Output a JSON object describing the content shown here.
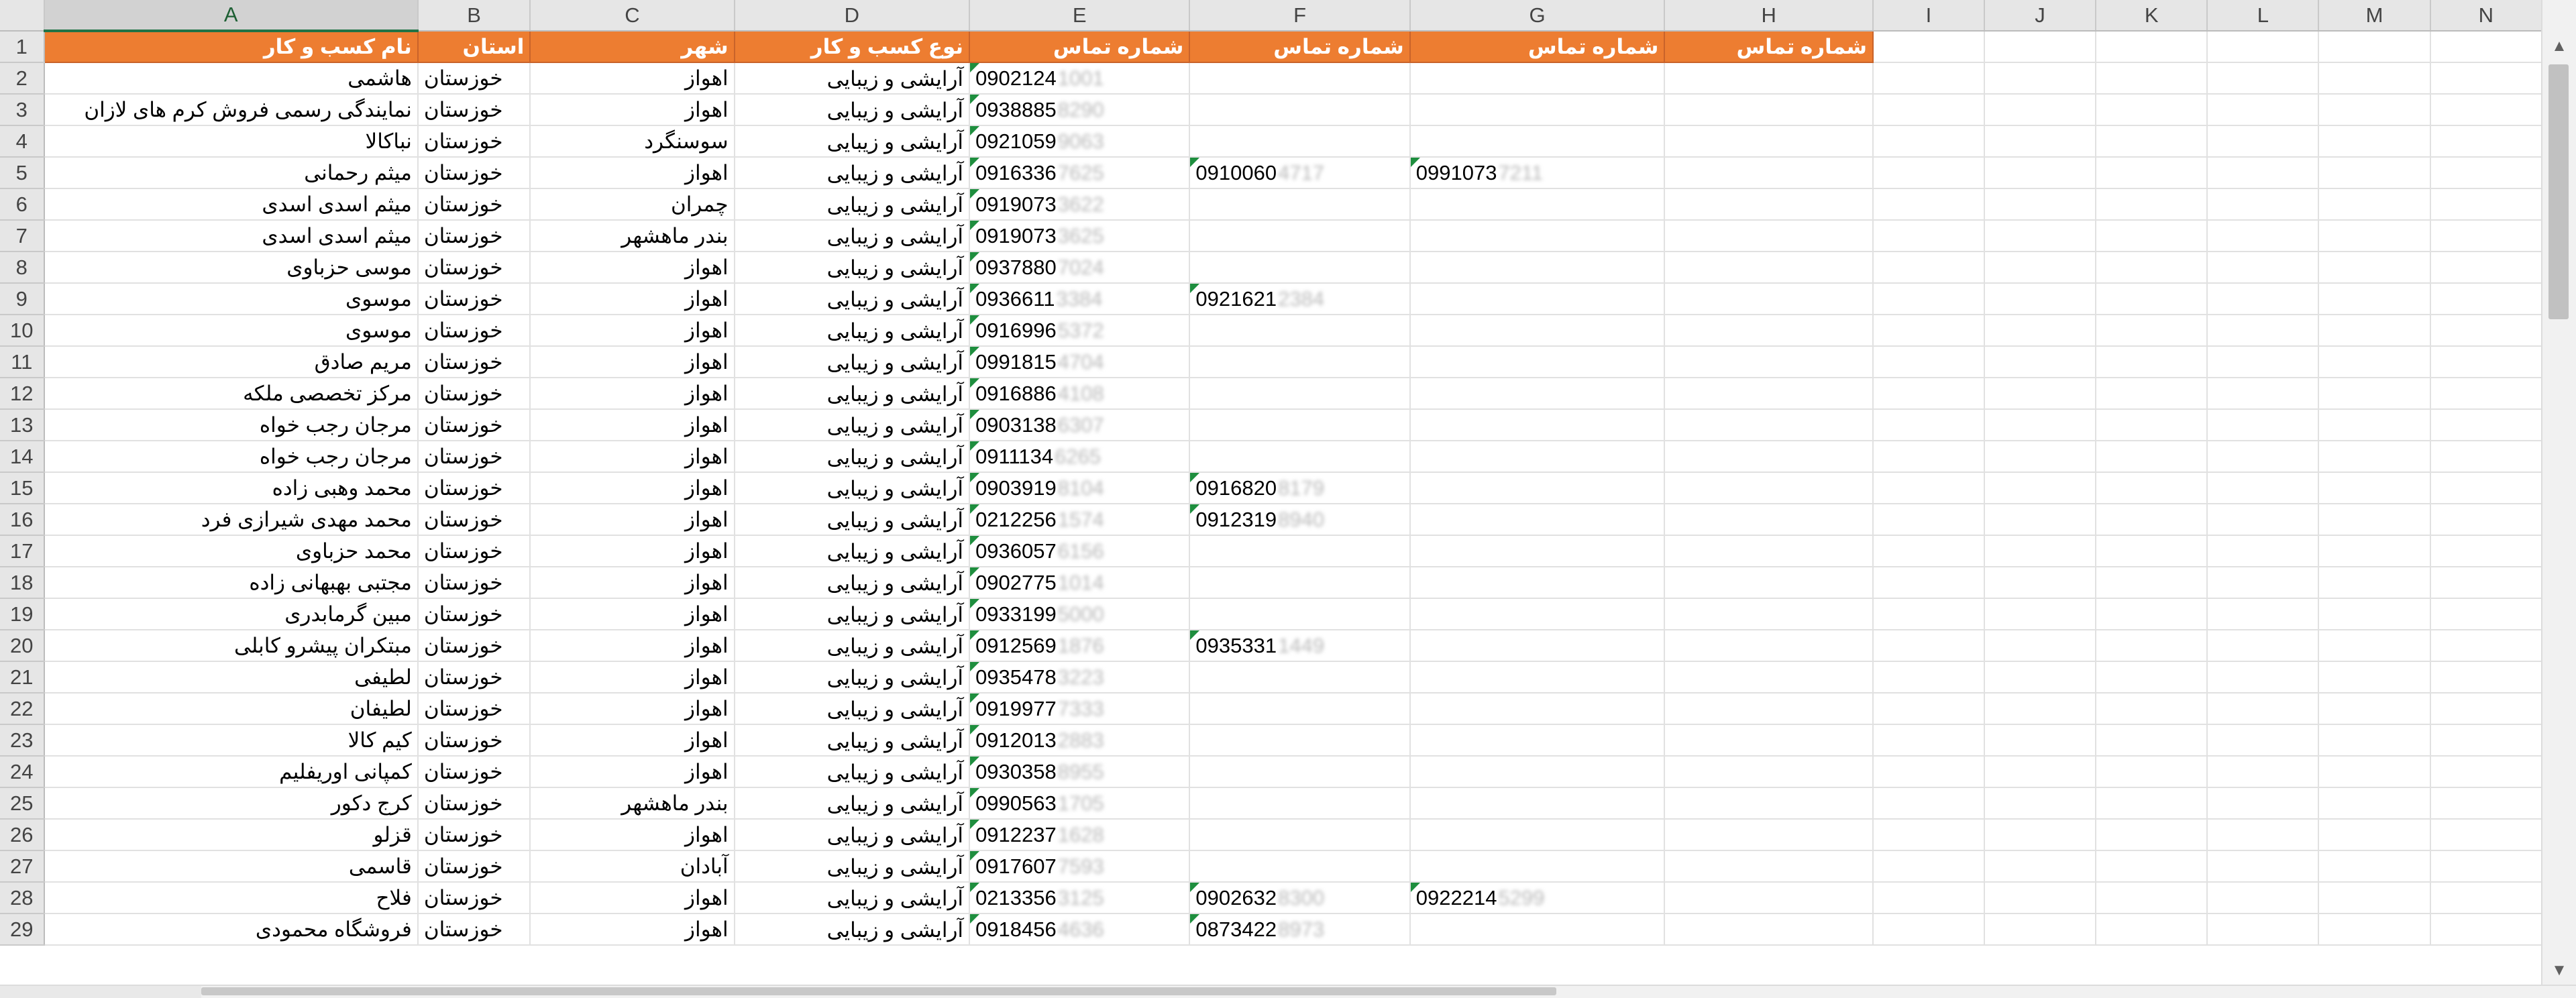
{
  "columns": [
    "A",
    "B",
    "C",
    "D",
    "E",
    "F",
    "G",
    "H",
    "I",
    "J",
    "K",
    "L",
    "M",
    "N"
  ],
  "header_row": {
    "row": "1",
    "A": "نام کسب و کار",
    "B": "استان",
    "C": "شهر",
    "D": "نوع کسب  و کار",
    "E": "شماره تماس",
    "F": "شماره تماس",
    "G": "شماره تماس",
    "H": "شماره تماس"
  },
  "rows": [
    {
      "row": "2",
      "name": "هاشمی",
      "province": "خوزستان",
      "city": "اهواز",
      "type": "آرایشی و زیبایی",
      "e": "0902124",
      "e_h": "1001",
      "f": "",
      "f_h": "",
      "g": "",
      "g_h": ""
    },
    {
      "row": "3",
      "name": "نمایندگی رسمی فروش کرم های لازان",
      "province": "خوزستان",
      "city": "اهواز",
      "type": "آرایشی و زیبایی",
      "e": "0938885",
      "e_h": "8290",
      "f": "",
      "f_h": "",
      "g": "",
      "g_h": ""
    },
    {
      "row": "4",
      "name": "نباکالا",
      "province": "خوزستان",
      "city": "سوسنگرد",
      "type": "آرایشی و زیبایی",
      "e": "0921059",
      "e_h": "9063",
      "f": "",
      "f_h": "",
      "g": "",
      "g_h": ""
    },
    {
      "row": "5",
      "name": "میثم رحمانی",
      "province": "خوزستان",
      "city": "اهواز",
      "type": "آرایشی و زیبایی",
      "e": "0916336",
      "e_h": "7625",
      "f": "0910060",
      "f_h": "4717",
      "g": "0991073",
      "g_h": "7211"
    },
    {
      "row": "6",
      "name": "میثم اسدی اسدی",
      "province": "خوزستان",
      "city": "چمران",
      "type": "آرایشی و زیبایی",
      "e": "0919073",
      "e_h": "3622",
      "f": "",
      "f_h": "",
      "g": "",
      "g_h": ""
    },
    {
      "row": "7",
      "name": "میثم اسدی اسدی",
      "province": "خوزستان",
      "city": "بندر ماهشهر",
      "type": "آرایشی و زیبایی",
      "e": "0919073",
      "e_h": "3625",
      "f": "",
      "f_h": "",
      "g": "",
      "g_h": ""
    },
    {
      "row": "8",
      "name": "موسی حزباوی",
      "province": "خوزستان",
      "city": "اهواز",
      "type": "آرایشی و زیبایی",
      "e": "0937880",
      "e_h": "7024",
      "f": "",
      "f_h": "",
      "g": "",
      "g_h": ""
    },
    {
      "row": "9",
      "name": "موسوی",
      "province": "خوزستان",
      "city": "اهواز",
      "type": "آرایشی و زیبایی",
      "e": "0936611",
      "e_h": "3384",
      "f": "0921621",
      "f_h": "2384",
      "g": "",
      "g_h": ""
    },
    {
      "row": "10",
      "name": "موسوی",
      "province": "خوزستان",
      "city": "اهواز",
      "type": "آرایشی و زیبایی",
      "e": "0916996",
      "e_h": "5372",
      "f": "",
      "f_h": "",
      "g": "",
      "g_h": ""
    },
    {
      "row": "11",
      "name": "مریم صادق",
      "province": "خوزستان",
      "city": "اهواز",
      "type": "آرایشی و زیبایی",
      "e": "0991815",
      "e_h": "4704",
      "f": "",
      "f_h": "",
      "g": "",
      "g_h": ""
    },
    {
      "row": "12",
      "name": "مرکز تخصصی ملکه",
      "province": "خوزستان",
      "city": "اهواز",
      "type": "آرایشی و زیبایی",
      "e": "0916886",
      "e_h": "4108",
      "f": "",
      "f_h": "",
      "g": "",
      "g_h": ""
    },
    {
      "row": "13",
      "name": "مرجان رجب خواه",
      "province": "خوزستان",
      "city": "اهواز",
      "type": "آرایشی و زیبایی",
      "e": "0903138",
      "e_h": "6307",
      "f": "",
      "f_h": "",
      "g": "",
      "g_h": ""
    },
    {
      "row": "14",
      "name": "مرجان رجب خواه",
      "province": "خوزستان",
      "city": "اهواز",
      "type": "آرایشی و زیبایی",
      "e": "0911134",
      "e_h": "6265",
      "f": "",
      "f_h": "",
      "g": "",
      "g_h": ""
    },
    {
      "row": "15",
      "name": "محمد وهبی زاده",
      "province": "خوزستان",
      "city": "اهواز",
      "type": "آرایشی و زیبایی",
      "e": "0903919",
      "e_h": "8104",
      "f": "0916820",
      "f_h": "8179",
      "g": "",
      "g_h": ""
    },
    {
      "row": "16",
      "name": "محمد مهدی شیرازی فرد",
      "province": "خوزستان",
      "city": "اهواز",
      "type": "آرایشی و زیبایی",
      "e": "0212256",
      "e_h": "1574",
      "f": "0912319",
      "f_h": "8940",
      "g": "",
      "g_h": ""
    },
    {
      "row": "17",
      "name": "محمد حزباوی",
      "province": "خوزستان",
      "city": "اهواز",
      "type": "آرایشی و زیبایی",
      "e": "0936057",
      "e_h": "6156",
      "f": "",
      "f_h": "",
      "g": "",
      "g_h": ""
    },
    {
      "row": "18",
      "name": "مجتبی بهبهانی زاده",
      "province": "خوزستان",
      "city": "اهواز",
      "type": "آرایشی و زیبایی",
      "e": "0902775",
      "e_h": "1014",
      "f": "",
      "f_h": "",
      "g": "",
      "g_h": ""
    },
    {
      "row": "19",
      "name": "مبین گرمابدری",
      "province": "خوزستان",
      "city": "اهواز",
      "type": "آرایشی و زیبایی",
      "e": "0933199",
      "e_h": "5000",
      "f": "",
      "f_h": "",
      "g": "",
      "g_h": ""
    },
    {
      "row": "20",
      "name": "مبتکران پیشرو کابلی",
      "province": "خوزستان",
      "city": "اهواز",
      "type": "آرایشی و زیبایی",
      "e": "0912569",
      "e_h": "1876",
      "f": "0935331",
      "f_h": "1449",
      "g": "",
      "g_h": ""
    },
    {
      "row": "21",
      "name": "لطیفی",
      "province": "خوزستان",
      "city": "اهواز",
      "type": "آرایشی و زیبایی",
      "e": "0935478",
      "e_h": "3223",
      "f": "",
      "f_h": "",
      "g": "",
      "g_h": ""
    },
    {
      "row": "22",
      "name": "لطیفان",
      "province": "خوزستان",
      "city": "اهواز",
      "type": "آرایشی و زیبایی",
      "e": "0919977",
      "e_h": "7333",
      "f": "",
      "f_h": "",
      "g": "",
      "g_h": ""
    },
    {
      "row": "23",
      "name": "کیم کالا",
      "province": "خوزستان",
      "city": "اهواز",
      "type": "آرایشی و زیبایی",
      "e": "0912013",
      "e_h": "2883",
      "f": "",
      "f_h": "",
      "g": "",
      "g_h": ""
    },
    {
      "row": "24",
      "name": "کمپانی اوریفلیم",
      "province": "خوزستان",
      "city": "اهواز",
      "type": "آرایشی و زیبایی",
      "e": "0930358",
      "e_h": "8955",
      "f": "",
      "f_h": "",
      "g": "",
      "g_h": ""
    },
    {
      "row": "25",
      "name": "کرج دکور",
      "province": "خوزستان",
      "city": "بندر ماهشهر",
      "type": "آرایشی و زیبایی",
      "e": "0990563",
      "e_h": "1705",
      "f": "",
      "f_h": "",
      "g": "",
      "g_h": ""
    },
    {
      "row": "26",
      "name": "قزلو",
      "province": "خوزستان",
      "city": "اهواز",
      "type": "آرایشی و زیبایی",
      "e": "0912237",
      "e_h": "1628",
      "f": "",
      "f_h": "",
      "g": "",
      "g_h": ""
    },
    {
      "row": "27",
      "name": "قاسمی",
      "province": "خوزستان",
      "city": "آبادان",
      "type": "آرایشی و زیبایی",
      "e": "0917607",
      "e_h": "7593",
      "f": "",
      "f_h": "",
      "g": "",
      "g_h": ""
    },
    {
      "row": "28",
      "name": "فلاح",
      "province": "خوزستان",
      "city": "اهواز",
      "type": "آرایشی و زیبایی",
      "e": "0213356",
      "e_h": "3125",
      "f": "0902632",
      "f_h": "8300",
      "g": "0922214",
      "g_h": "5299"
    },
    {
      "row": "29",
      "name": "فروشگاه محمودی",
      "province": "خوزستان",
      "city": "اهواز",
      "type": "آرایشی و زیبایی",
      "e": "0918456",
      "e_h": "4636",
      "f": "0873422",
      "f_h": "8973",
      "g": "",
      "g_h": ""
    }
  ],
  "colors": {
    "header_fill": "#ed7d31",
    "header_text": "#ffffff",
    "error_triangle": "#1e8e3e",
    "selected_column_header": "#217346"
  },
  "icons": {
    "scroll_up": "▲",
    "scroll_down": "▼"
  }
}
